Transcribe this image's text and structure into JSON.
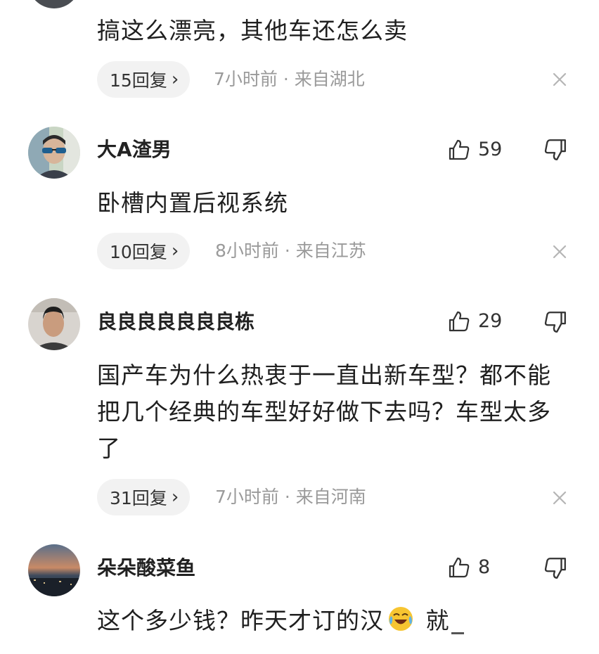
{
  "comments": [
    {
      "text": "搞这么漂亮，其他车还怎么卖",
      "reply_label": "15回复",
      "meta": "7小时前 · 来自湖北"
    },
    {
      "username": "大A渣男",
      "likes": "59",
      "text": "卧槽内置后视系统",
      "reply_label": "10回复",
      "meta": "8小时前 · 来自江苏"
    },
    {
      "username": "良良良良良良良栋",
      "likes": "29",
      "text": "国产车为什么热衷于一直出新车型？都不能把几个经典的车型好好做下去吗？车型太多了",
      "reply_label": "31回复",
      "meta": "7小时前 · 来自河南"
    },
    {
      "username": "朵朵酸菜鱼",
      "likes": "8",
      "text_before_emoji": "这个多少钱？昨天才订的汉",
      "text_after_emoji": " 就",
      "emoji_icon": "crying-laughing-emoji"
    }
  ],
  "icons": {
    "like": "thumbs-up-icon",
    "dislike": "thumbs-down-icon",
    "dismiss": "close-icon",
    "chevron": "chevron-right-icon"
  },
  "colors": {
    "pill_bg": "#f2f2f2",
    "meta_text": "#9a9a9a"
  }
}
